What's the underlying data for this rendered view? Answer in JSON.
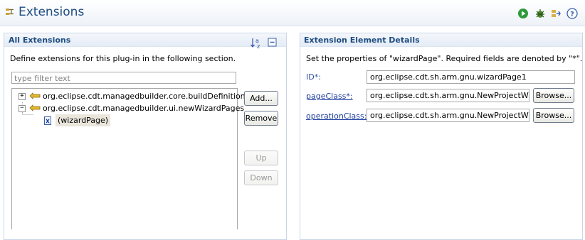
{
  "header": {
    "title": "Extensions"
  },
  "left_section": {
    "title": "All Extensions",
    "description": "Define extensions for this plug-in in the following section.",
    "filter_placeholder": "type filter text",
    "tree": [
      {
        "label": "org.eclipse.cdt.managedbuilder.core.buildDefinitions",
        "expander": "+"
      },
      {
        "label": "org.eclipse.cdt.managedbuilder.ui.newWizardPages",
        "expander": "−"
      },
      {
        "label": "(wizardPage)"
      }
    ],
    "buttons": {
      "add": "Add...",
      "remove": "Remove",
      "up": "Up",
      "down": "Down"
    }
  },
  "right_section": {
    "title": "Extension Element Details",
    "description": "Set the properties of \"wizardPage\". Required fields are denoted by \"*\".",
    "fields": {
      "id": {
        "label": "ID*:",
        "value": "org.eclipse.cdt.sh.arm.gnu.wizardPage1"
      },
      "page_class": {
        "label": "pageClass*:",
        "value": "org.eclipse.cdt.sh.arm.gnu.NewProjectWizarc",
        "browse": "Browse..."
      },
      "operation_class": {
        "label": "operationClass:",
        "value": "org.eclipse.cdt.sh.arm.gnu.NewProjectWizarc",
        "browse": "Browse..."
      }
    }
  },
  "icons": {
    "header": "extensions-icon",
    "run": "run-icon",
    "debug": "debug-icon",
    "export": "export-wizard-icon",
    "help": "help-icon",
    "sort": "sort-alphabetical-icon",
    "collapse": "collapse-all-icon"
  },
  "colors": {
    "title": "#1f4d82",
    "section_border": "#c9d6e6",
    "link": "#1b3b9e",
    "selection": "#eae6dc"
  }
}
